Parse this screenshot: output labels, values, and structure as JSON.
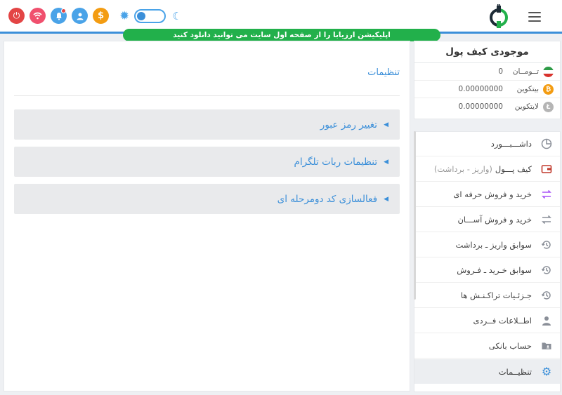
{
  "header": {
    "icons": [
      "power-icon",
      "wifi-icon",
      "bell-icon",
      "user-icon",
      "dollar-icon"
    ],
    "theme_toggle": {
      "sun_icon": "sun-icon",
      "moon_icon": "moon-icon",
      "state": "light"
    },
    "app_banner": "اپلیکیشن ارزیابا را از صفحه اول سایت می توانید دانلود کنید"
  },
  "main": {
    "title": "تنظیمات",
    "accordions": [
      {
        "label": "تغییر رمز عبور"
      },
      {
        "label": "تنظیمات ربات تلگرام"
      },
      {
        "label": "فعالسازی کد دومرحله ای"
      }
    ]
  },
  "wallet": {
    "title": "موجودی کیف پول",
    "rows": [
      {
        "name": "تــومــان",
        "value": "0",
        "icon": "iran-flag-icon"
      },
      {
        "name": "بیتکوین",
        "value": "0.00000000",
        "icon": "bitcoin-icon"
      },
      {
        "name": "لایتکوین",
        "value": "0.00000000",
        "icon": "litecoin-icon"
      }
    ]
  },
  "menu": {
    "items": [
      {
        "label": "داشـــبـــورد",
        "sub": "",
        "icon": "dashboard-icon"
      },
      {
        "label": "کیف پـــول",
        "sub": "(واریز - برداشت)",
        "icon": "wallet-icon"
      },
      {
        "label": "خرید و فروش حرفه ای",
        "sub": "",
        "icon": "pro-exchange-icon"
      },
      {
        "label": "خرید و فروش آســـان",
        "sub": "",
        "icon": "exchange-icon"
      },
      {
        "label": "سوابق واریز ـ برداشت",
        "sub": "",
        "icon": "history-icon"
      },
      {
        "label": "سوابق خـرید ـ فـروش",
        "sub": "",
        "icon": "history-icon"
      },
      {
        "label": "جـزئـیات تراکـنـش ها",
        "sub": "",
        "icon": "history-icon"
      },
      {
        "label": "اطــلاعات فــردی",
        "sub": "",
        "icon": "person-icon"
      },
      {
        "label": "حساب بانکی",
        "sub": "",
        "icon": "bank-folder-icon"
      },
      {
        "label": "تنظیــمات",
        "sub": "",
        "icon": "gear-icon"
      }
    ],
    "active_index": 9
  },
  "colors": {
    "accent": "#3b8fd9",
    "banner": "#22b04b"
  }
}
